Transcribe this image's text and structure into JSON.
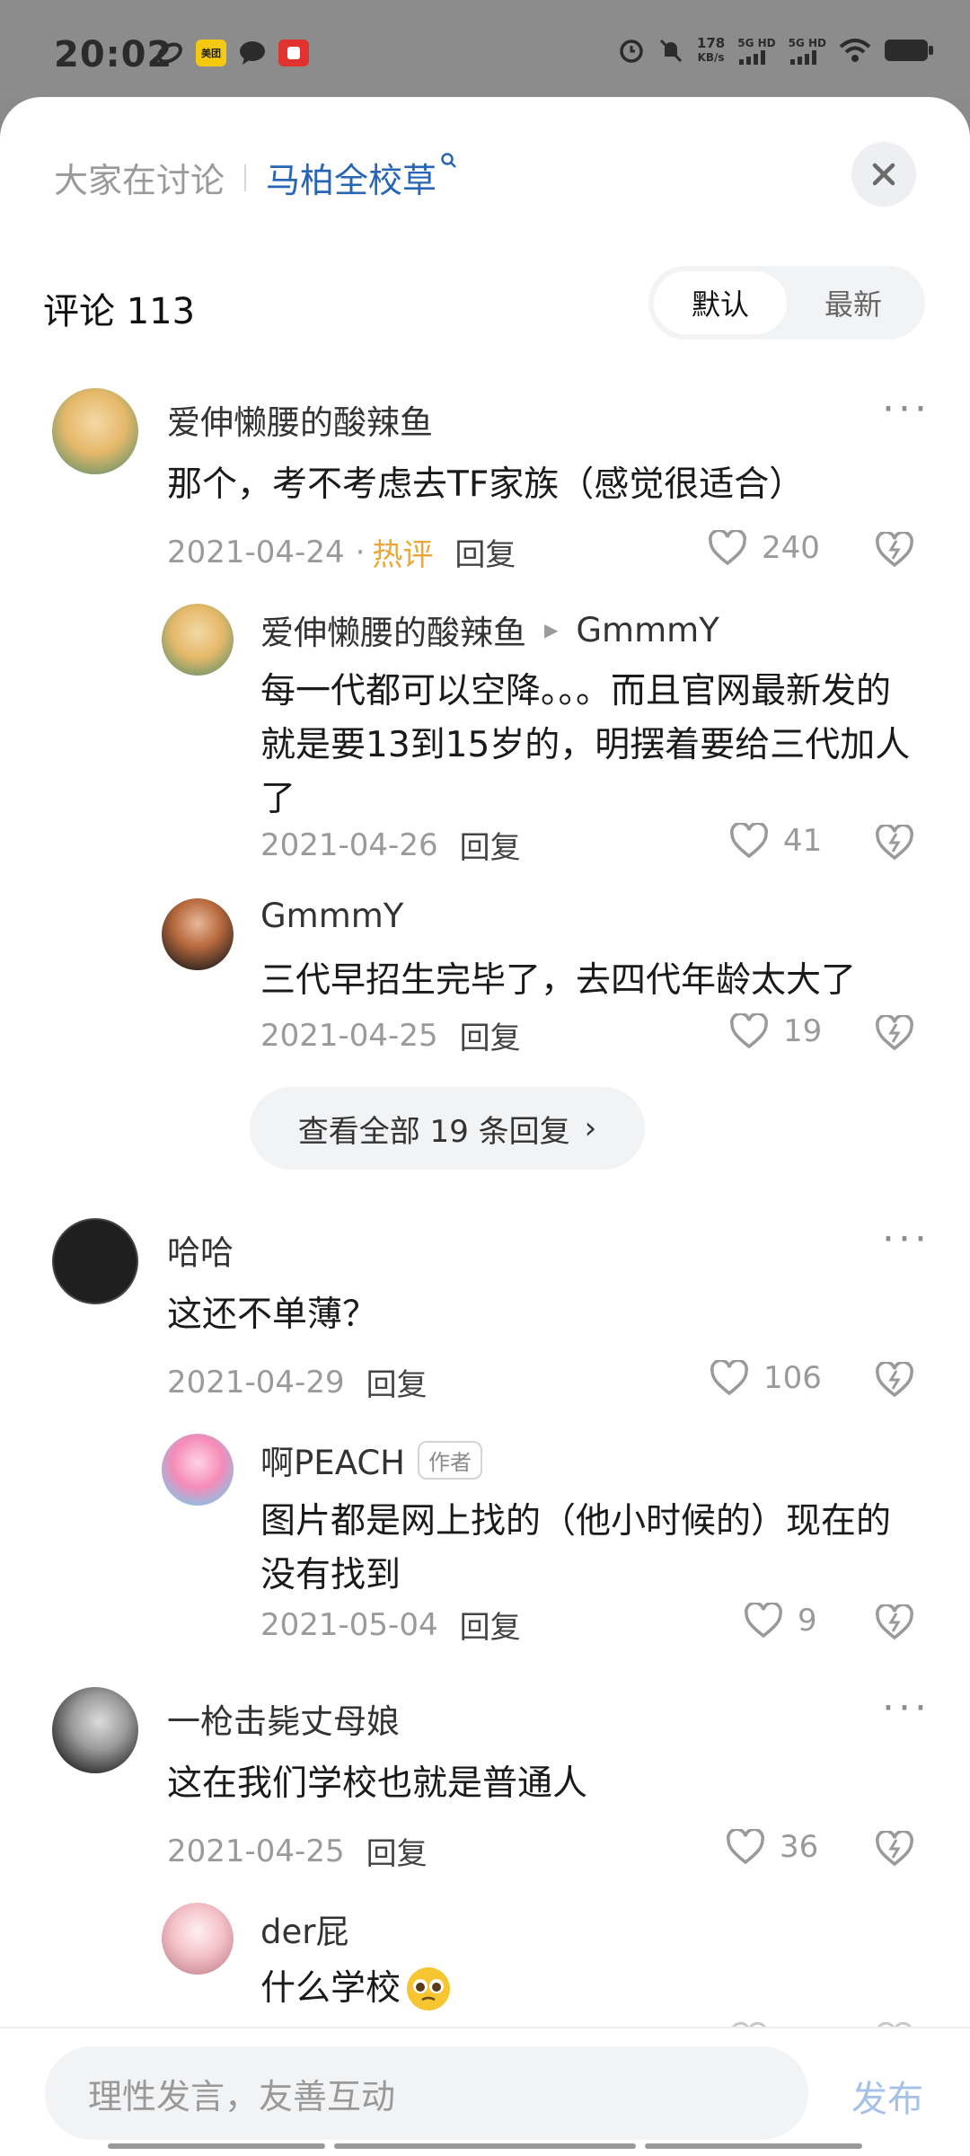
{
  "status": {
    "time": "20:02",
    "speed": "178",
    "speed_unit": "KB/s",
    "net1": "5G HD",
    "net2": "5G HD",
    "app1": "美团"
  },
  "header": {
    "topic_prefix": "大家在讨论",
    "topic": "马柏全校草"
  },
  "comments_header": {
    "count_label": "评论 113",
    "tab_default": "默认",
    "tab_latest": "最新"
  },
  "comments": [
    {
      "user": "爱伸懒腰的酸辣鱼",
      "text": "那个，考不考虑去TF家族（感觉很适合）",
      "date": "2021-04-24",
      "hot_label": "热评",
      "reply_label": "回复",
      "likes": "240",
      "replies": [
        {
          "user": "爱伸懒腰的酸辣鱼",
          "to": "GmmmY",
          "text": "每一代都可以空降。。。而且官网最新发的就是要13到15岁的，明摆着要给三代加人了",
          "date": "2021-04-26",
          "reply_label": "回复",
          "likes": "41"
        },
        {
          "user": "GmmmY",
          "text": "三代早招生完毕了，去四代年龄太大了",
          "date": "2021-04-25",
          "reply_label": "回复",
          "likes": "19"
        }
      ],
      "view_all": "查看全部 19 条回复"
    },
    {
      "user": "哈哈",
      "text": "这还不单薄？",
      "date": "2021-04-29",
      "reply_label": "回复",
      "likes": "106",
      "replies": [
        {
          "user": "啊PEACH",
          "badge": "作者",
          "text": "图片都是网上找的（他小时候的）现在的没有找到",
          "date": "2021-05-04",
          "reply_label": "回复",
          "likes": "9"
        }
      ]
    },
    {
      "user": "一枪击毙丈母娘",
      "text": "这在我们学校也就是普通人",
      "date": "2021-04-25",
      "reply_label": "回复",
      "likes": "36",
      "replies": [
        {
          "user": "der屁",
          "text": "什么学校"
        }
      ]
    }
  ],
  "bottom": {
    "placeholder": "理性发言，友善互动",
    "publish": "发布"
  }
}
